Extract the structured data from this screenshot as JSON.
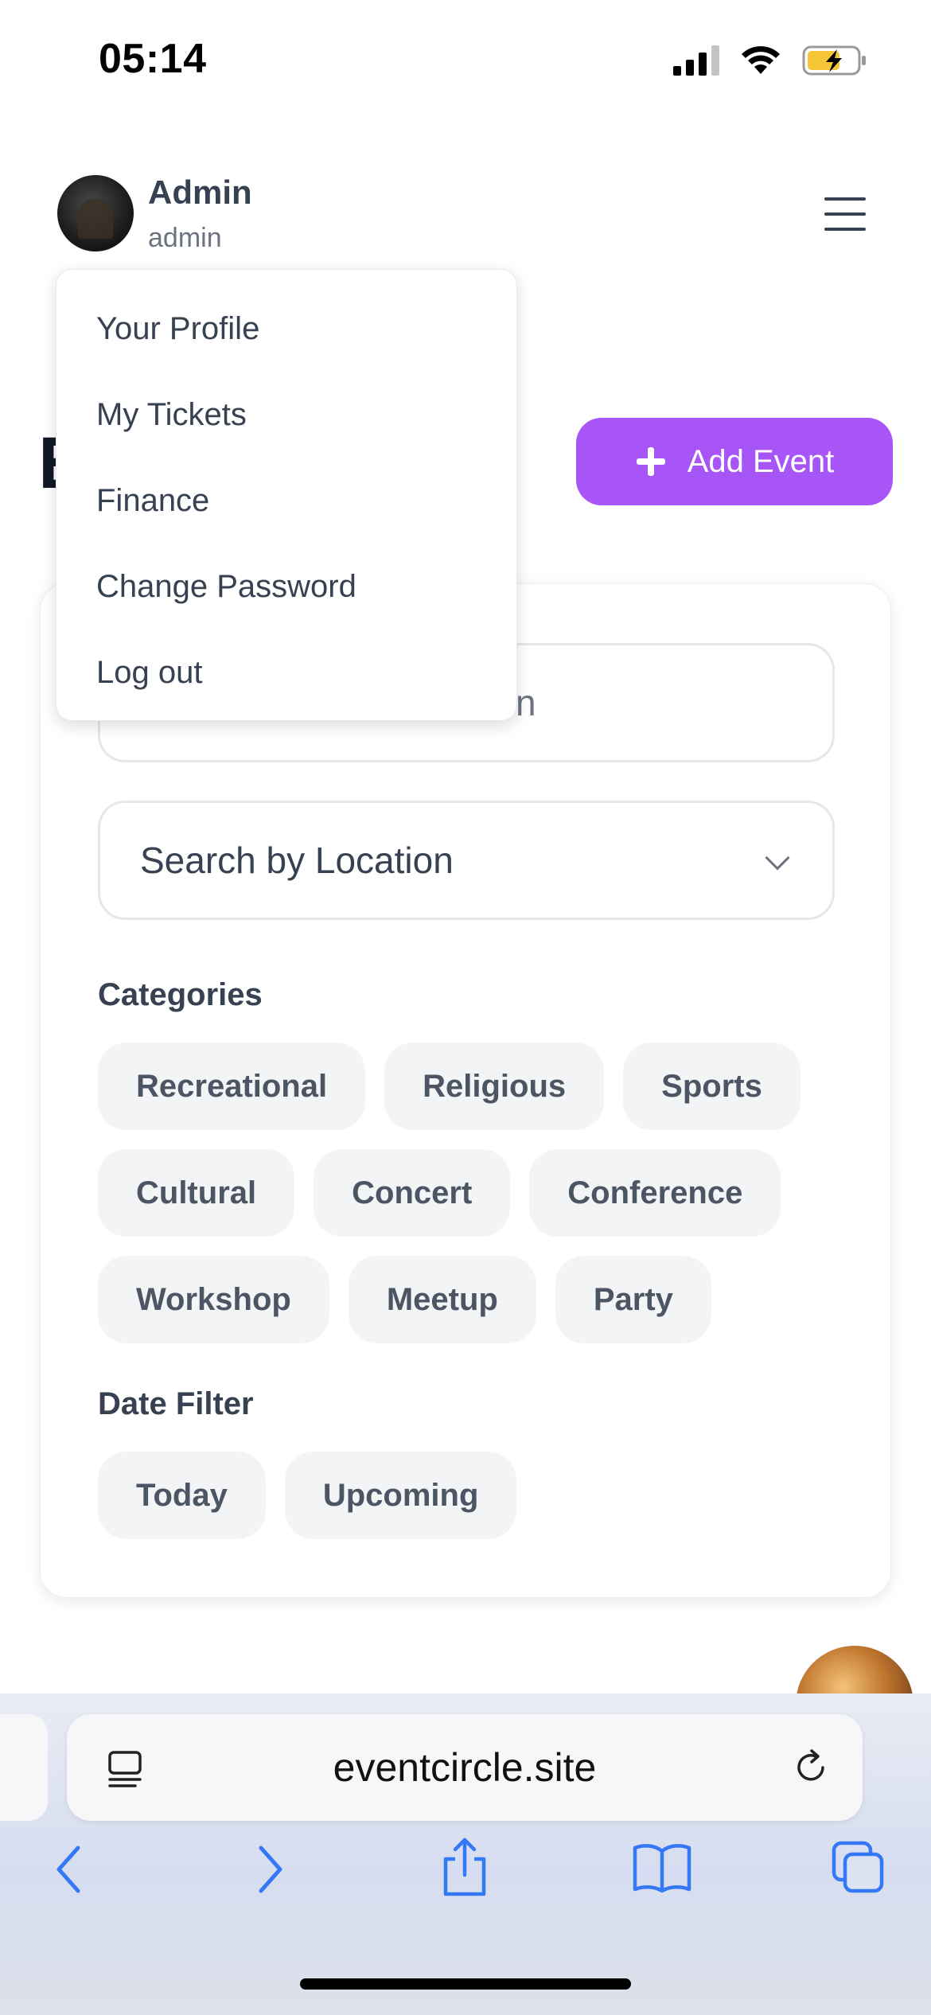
{
  "status_bar": {
    "time": "05:14"
  },
  "header": {
    "user_name": "Admin",
    "user_role": "admin"
  },
  "page": {
    "title_visible": "E"
  },
  "add_event": {
    "label": "Add Event"
  },
  "filters": {
    "search_visible_text": "n",
    "location_placeholder": "Search by Location",
    "categories_label": "Categories",
    "categories": [
      "Recreational",
      "Religious",
      "Sports",
      "Cultural",
      "Concert",
      "Conference",
      "Workshop",
      "Meetup",
      "Party"
    ],
    "date_filter_label": "Date Filter",
    "date_filters": [
      "Today",
      "Upcoming"
    ]
  },
  "dropdown": {
    "items": [
      "Your Profile",
      "My Tickets",
      "Finance",
      "Change Password",
      "Log out"
    ]
  },
  "browser": {
    "url": "eventcircle.site"
  },
  "colors": {
    "accent": "#a855f7",
    "chip_bg": "#f3f4f6",
    "safari_blue": "#3478f6"
  }
}
